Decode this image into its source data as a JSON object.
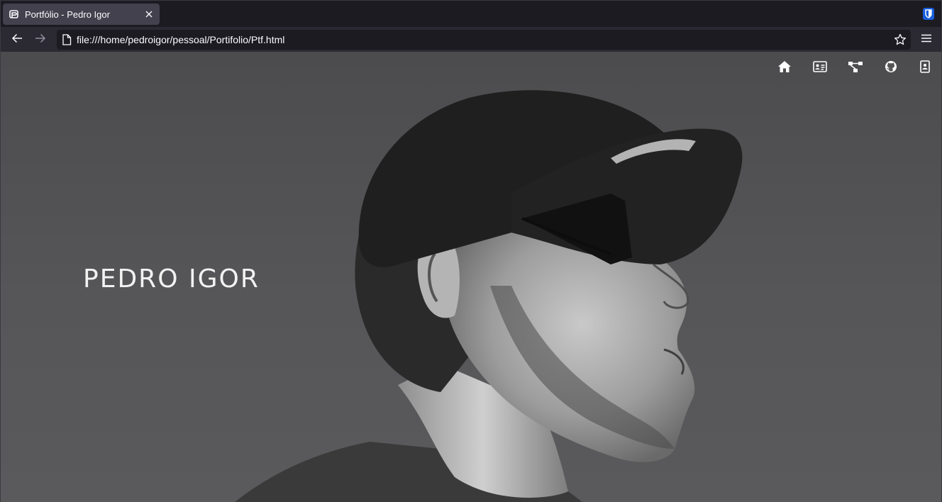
{
  "browser": {
    "tab": {
      "title": "Portfólio - Pedro Igor",
      "favicon": "portfolio-p-icon",
      "close_icon": "close-icon"
    },
    "extension_icon": "bitwarden-shield-icon",
    "nav": {
      "back_icon": "back-arrow-icon",
      "forward_icon": "forward-arrow-icon",
      "url": "file:///home/pedroigor/pessoal/Portifolio/Ptf.html",
      "page_icon": "page-icon",
      "bookmark_icon": "star-icon",
      "menu_icon": "hamburger-menu-icon"
    }
  },
  "site": {
    "hero_name": "PEDRO IGOR",
    "nav_icons": [
      "home-icon",
      "id-card-icon",
      "diagram-icon",
      "github-icon",
      "contact-icon"
    ]
  },
  "colors": {
    "chrome_dark": "#1c1b22",
    "tab_active": "#42414d",
    "text_light": "#fbfbfe",
    "page_bg": "#565658"
  }
}
